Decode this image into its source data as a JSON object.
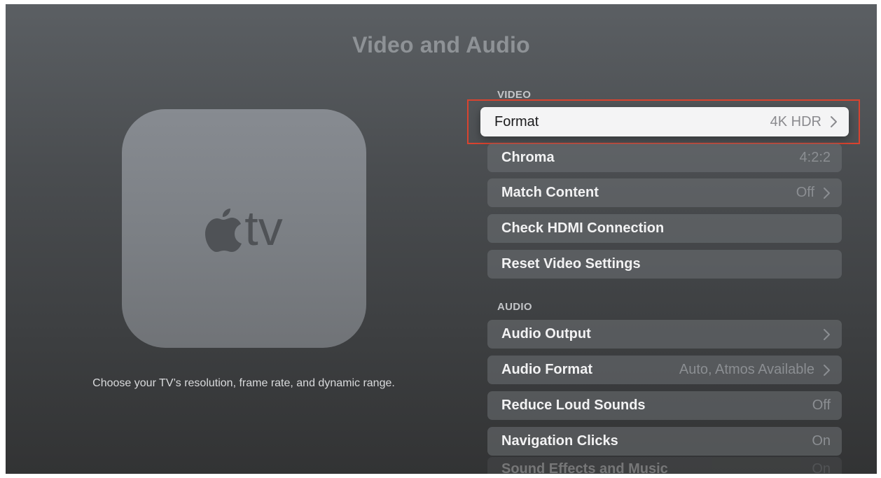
{
  "page": {
    "title": "Video and Audio"
  },
  "device": {
    "logo_text": "tv",
    "logo_icon": "apple-logo-icon"
  },
  "description": "Choose your TV’s resolution, frame rate, and dynamic range.",
  "video": {
    "header": "VIDEO",
    "items": [
      {
        "label": "Format",
        "value": "4K HDR",
        "chevron": true,
        "focused": true
      },
      {
        "label": "Chroma",
        "value": "4:2:2",
        "chevron": false
      },
      {
        "label": "Match Content",
        "value": "Off",
        "chevron": true
      },
      {
        "label": "Check HDMI Connection",
        "value": "",
        "chevron": false
      },
      {
        "label": "Reset Video Settings",
        "value": "",
        "chevron": false
      }
    ]
  },
  "audio": {
    "header": "AUDIO",
    "items": [
      {
        "label": "Audio Output",
        "value": "",
        "chevron": true
      },
      {
        "label": "Audio Format",
        "value": "Auto, Atmos Available",
        "chevron": true
      },
      {
        "label": "Reduce Loud Sounds",
        "value": "Off",
        "chevron": false
      },
      {
        "label": "Navigation Clicks",
        "value": "On",
        "chevron": false
      },
      {
        "label": "Sound Effects and Music",
        "value": "On",
        "chevron": false
      }
    ]
  },
  "colors": {
    "highlight_border": "#d9432f",
    "focused_row": "#f4f4f5"
  }
}
